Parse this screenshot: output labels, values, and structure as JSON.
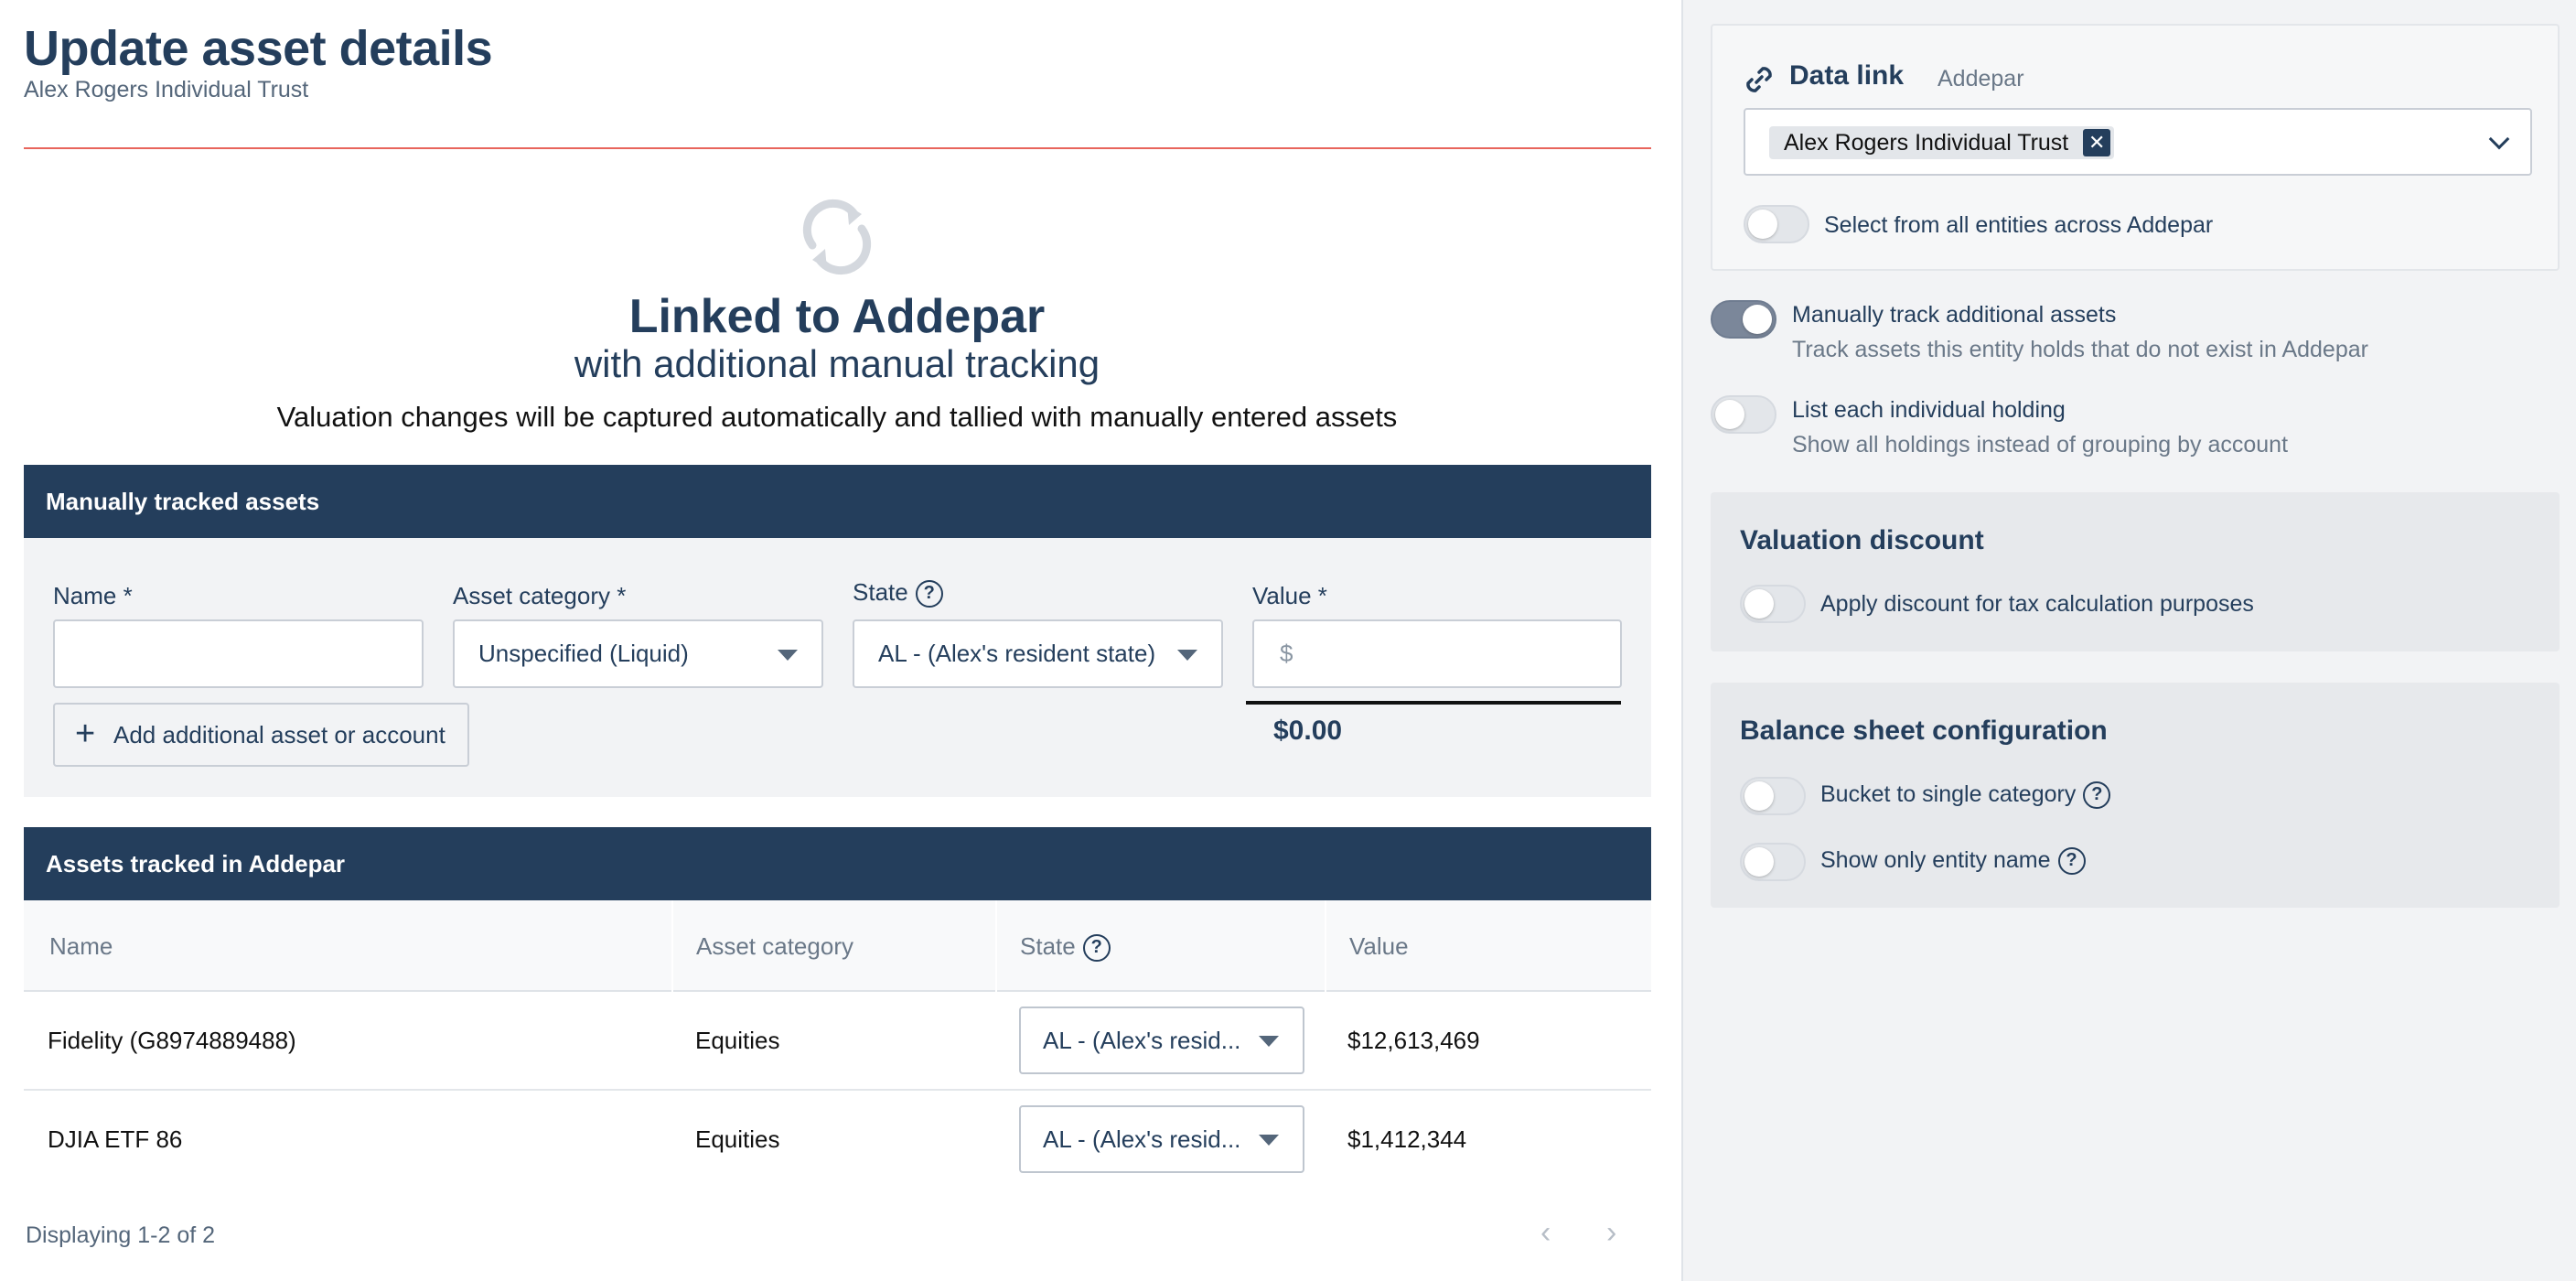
{
  "page": {
    "title": "Update asset details",
    "subtitle": "Alex Rogers Individual Trust"
  },
  "linked": {
    "title": "Linked to Addepar",
    "subtitle": "with additional manual tracking",
    "description": "Valuation changes will be captured automatically and tallied with manually entered assets",
    "icon": "sync-icon"
  },
  "manual_section": {
    "header": "Manually tracked assets",
    "labels": {
      "name": "Name *",
      "category": "Asset category *",
      "state": "State",
      "value": "Value *"
    },
    "name_value": "",
    "category_value": "Unspecified (Liquid)",
    "state_value": "AL - (Alex's resident state)",
    "value_prefix": "$",
    "add_button": "Add additional asset or account",
    "total": "$0.00"
  },
  "addepar_section": {
    "header": "Assets tracked in Addepar",
    "columns": [
      "Name",
      "Asset category",
      "State",
      "Value"
    ],
    "rows": [
      {
        "name": "Fidelity (G8974889488)",
        "category": "Equities",
        "state": "AL - (Alex's resid...",
        "value": "$12,613,469"
      },
      {
        "name": "DJIA ETF 86",
        "category": "Equities",
        "state": "AL - (Alex's resid...",
        "value": "$1,412,344"
      }
    ],
    "footer": "Displaying 1-2 of 2",
    "pager_prev": "‹",
    "pager_next": "›"
  },
  "sidebar": {
    "data_link": {
      "title": "Data link",
      "source": "Addepar",
      "selected_entity": "Alex Rogers Individual Trust",
      "remove_symbol": "✕",
      "all_entities_label": "Select from all entities across Addepar",
      "all_entities_on": false
    },
    "manual_track": {
      "label": "Manually track additional assets",
      "description": "Track assets this entity holds that do not exist in Addepar",
      "on": true
    },
    "list_holdings": {
      "label": "List each individual holding",
      "description": "Show all holdings instead of grouping by account",
      "on": false
    },
    "valuation_discount": {
      "title": "Valuation discount",
      "toggle_label": "Apply discount for tax calculation purposes",
      "on": false
    },
    "balance_sheet": {
      "title": "Balance sheet configuration",
      "bucket_label": "Bucket to single category",
      "entity_name_label": "Show only entity name",
      "bucket_on": false,
      "entity_name_on": false
    }
  },
  "colors": {
    "navy": "#243e5c",
    "accent_rule": "#e8655c",
    "panel": "#f2f3f5"
  }
}
